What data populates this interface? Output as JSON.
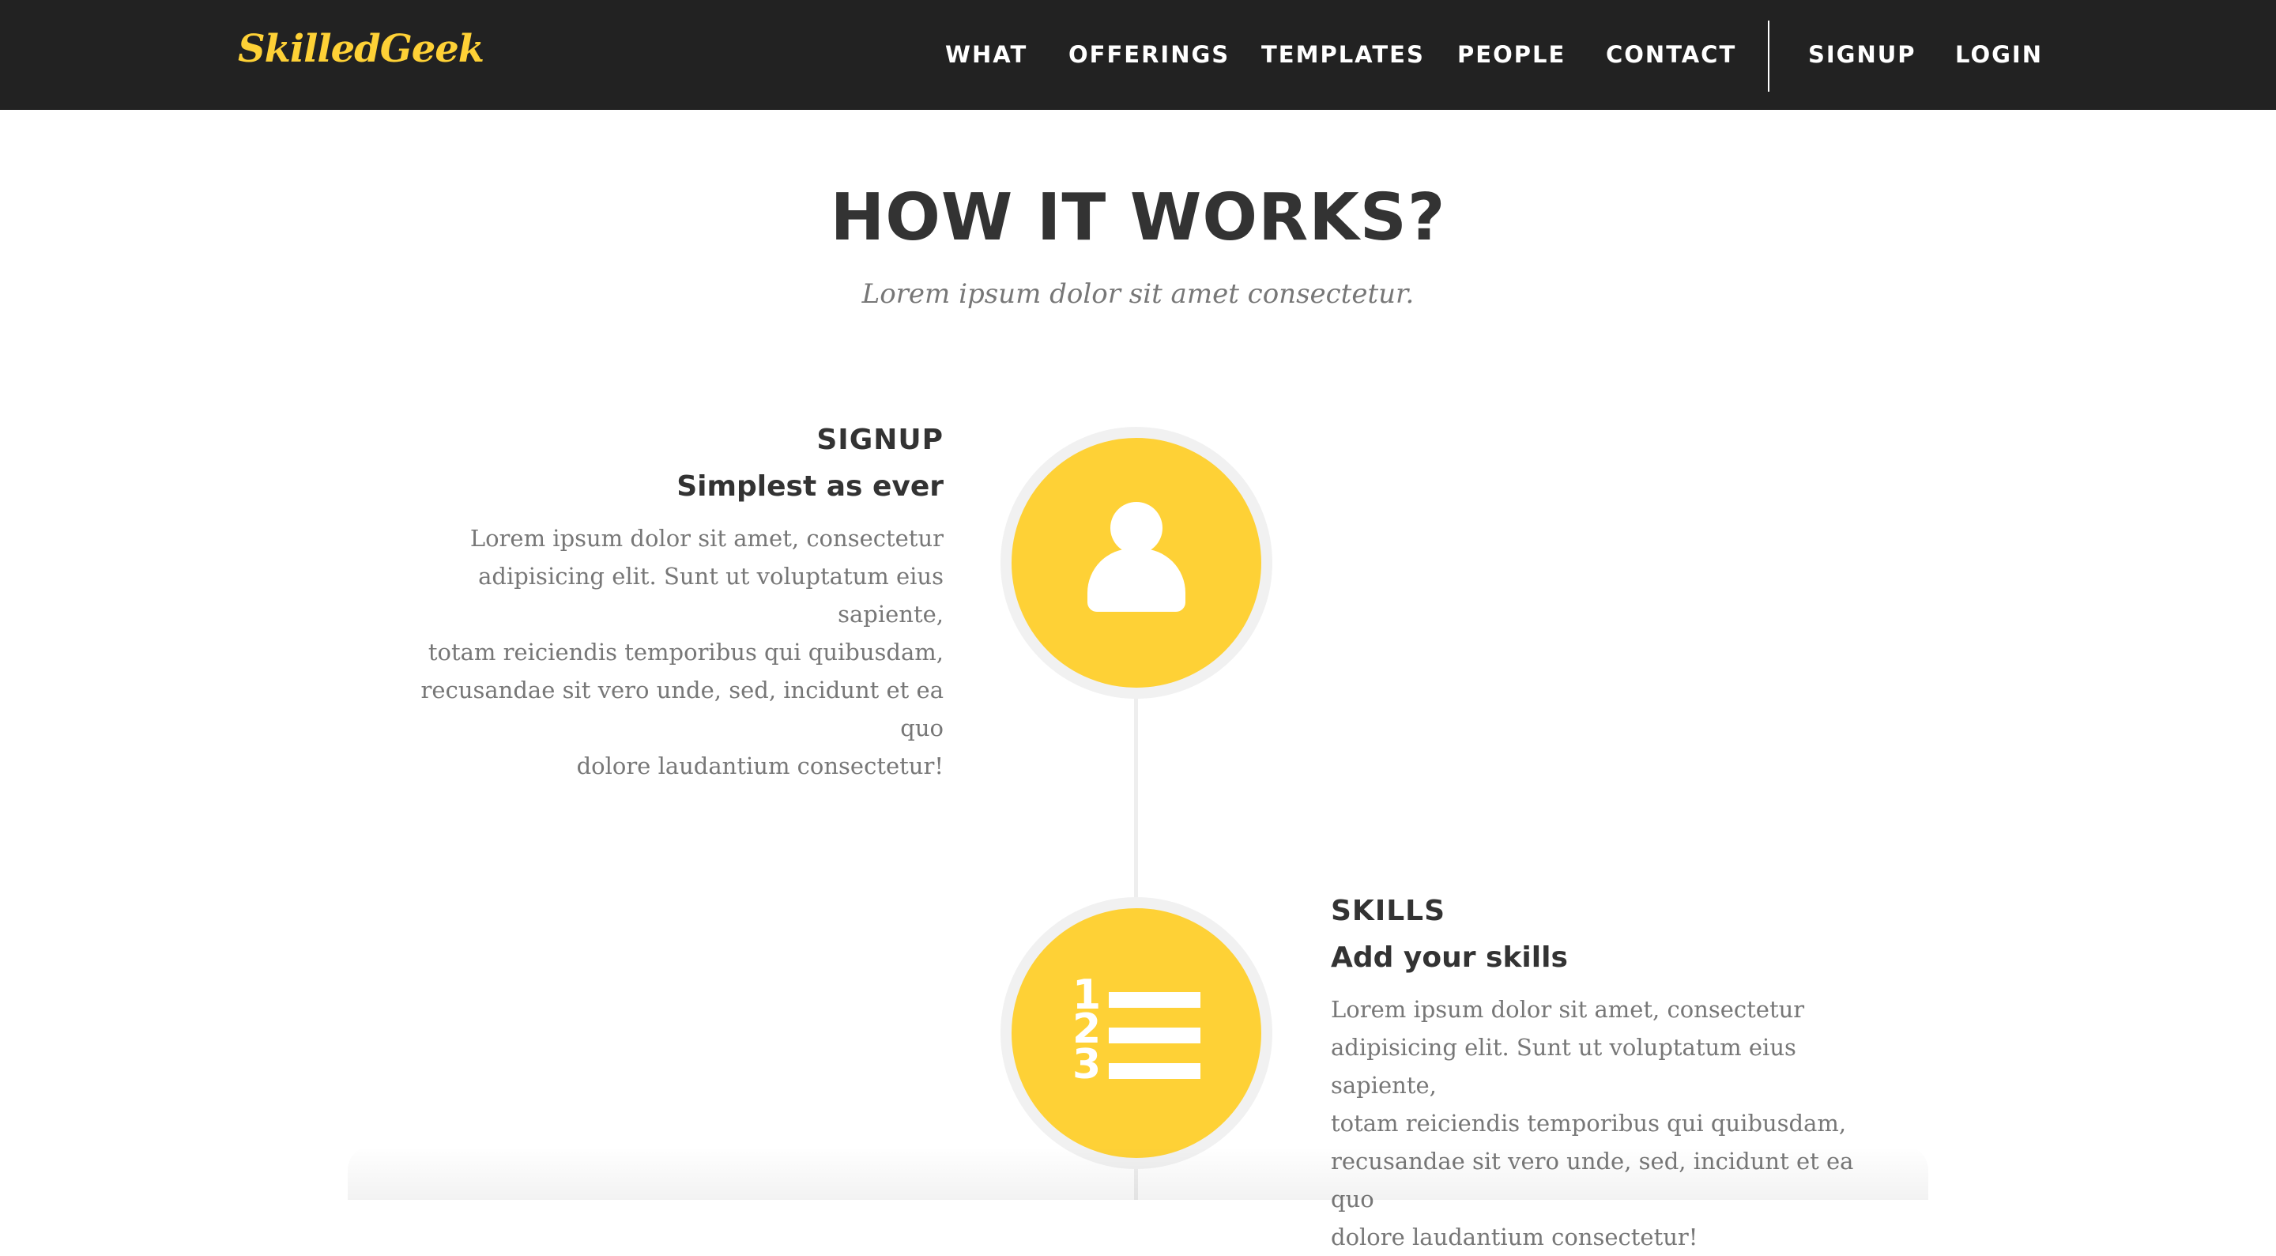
{
  "navbar": {
    "brand": "SkilledGeek",
    "links": [
      "WHAT",
      "OFFERINGS",
      "TEMPLATES",
      "PEOPLE",
      "CONTACT"
    ],
    "auth": [
      "SIGNUP",
      "LOGIN"
    ],
    "brand_color": "#fed136",
    "background": "#222222"
  },
  "section": {
    "title": "HOW IT WORKS?",
    "subtitle": "Lorem ipsum dolor sit amet consectetur."
  },
  "timeline": {
    "accent_color": "#fed136",
    "steps": [
      {
        "heading": "SIGNUP",
        "subheading": "Simplest as ever",
        "icon": "user-icon",
        "body_lines": [
          "Lorem ipsum dolor sit amet, consectetur",
          "adipisicing elit. Sunt ut voluptatum eius sapiente,",
          "totam reiciendis temporibus qui quibusdam,",
          "recusandae sit vero unde, sed, incidunt et ea quo",
          "dolore laudantium consectetur!"
        ]
      },
      {
        "heading": "SKILLS",
        "subheading": "Add your skills",
        "icon": "numbered-list-icon",
        "icon_numbers": [
          "1",
          "2",
          "3"
        ],
        "body_lines": [
          "Lorem ipsum dolor sit amet, consectetur",
          "adipisicing elit. Sunt ut voluptatum eius sapiente,",
          "totam reiciendis temporibus qui quibusdam,",
          "recusandae sit vero unde, sed, incidunt et ea quo",
          "dolore laudantium consectetur!"
        ]
      }
    ]
  }
}
